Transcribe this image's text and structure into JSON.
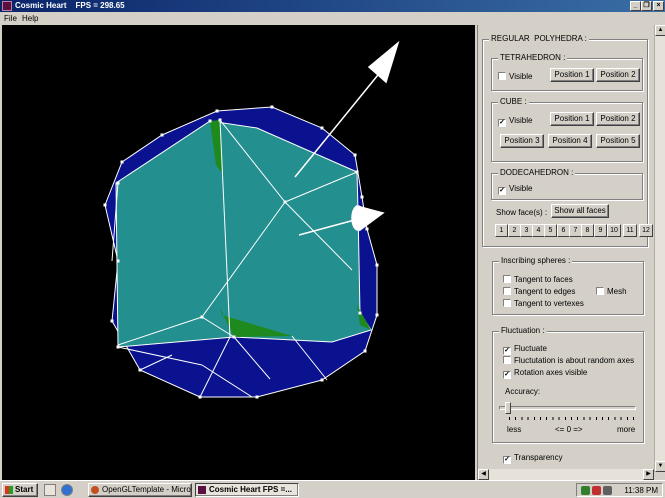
{
  "window": {
    "title": "Cosmic Heart    FPS = 298.65",
    "controls": {
      "minimize": "_",
      "maximize": "❐",
      "close": "×"
    }
  },
  "menu": {
    "items": [
      "File",
      "Help"
    ]
  },
  "panel": {
    "regular_polyhedra": {
      "legend": "REGULAR  POLYHEDRA :",
      "tetrahedron": {
        "legend": "TETRAHEDRON :",
        "visible_label": "Visible",
        "visible_checked": false,
        "buttons": [
          "Position 1",
          "Position 2"
        ]
      },
      "cube": {
        "legend": "CUBE :",
        "visible_label": "Visible",
        "visible_checked": true,
        "buttons": [
          "Position 1",
          "Position 2",
          "Position 3",
          "Position 4",
          "Position 5"
        ]
      },
      "dodecahedron": {
        "legend": "DODECAHEDRON :",
        "visible_label": "Visible",
        "visible_checked": true
      },
      "show_faces_label": "Show face(s) :",
      "show_all_faces": "Show all faces",
      "faces": [
        "1",
        "2",
        "3",
        "4",
        "5",
        "6",
        "7",
        "8",
        "9",
        "10",
        "11",
        "12"
      ]
    },
    "inscribing_spheres": {
      "legend": "Inscribing spheres :",
      "tangent_faces": "Tangent to faces",
      "tangent_edges": "Tangent to edges",
      "tangent_vertexes": "Tangent to vertexes",
      "mesh": "Mesh"
    },
    "fluctuation": {
      "legend": "Fluctuation :",
      "fluctuate": "Fluctuate",
      "fluctuate_checked": true,
      "random_axes": "Fluctutation is about random axes",
      "random_axes_checked": false,
      "rotation_axes": "Rotation axes visible",
      "rotation_axes_checked": true,
      "accuracy_label": "Accuracy:",
      "less": "less",
      "center": "<= 0 =>",
      "more": "more",
      "accuracy_value": 0
    },
    "transparency": {
      "label": "Transparency",
      "checked": true
    }
  },
  "taskbar": {
    "start": "Start",
    "tasks": [
      {
        "label": "OpenGLTemplate - Micros...",
        "active": false
      },
      {
        "label": "Cosmic Heart    FPS =...",
        "active": true
      }
    ],
    "clock": "11:38 PM"
  },
  "colors": {
    "viewport_bg": "#000000",
    "dodecahedron": "#0a1290",
    "cube": "#238f8f",
    "tetrahedron_hint": "#1e8a1e",
    "edges": "#ffffff",
    "titlebar": "#0a246a"
  }
}
